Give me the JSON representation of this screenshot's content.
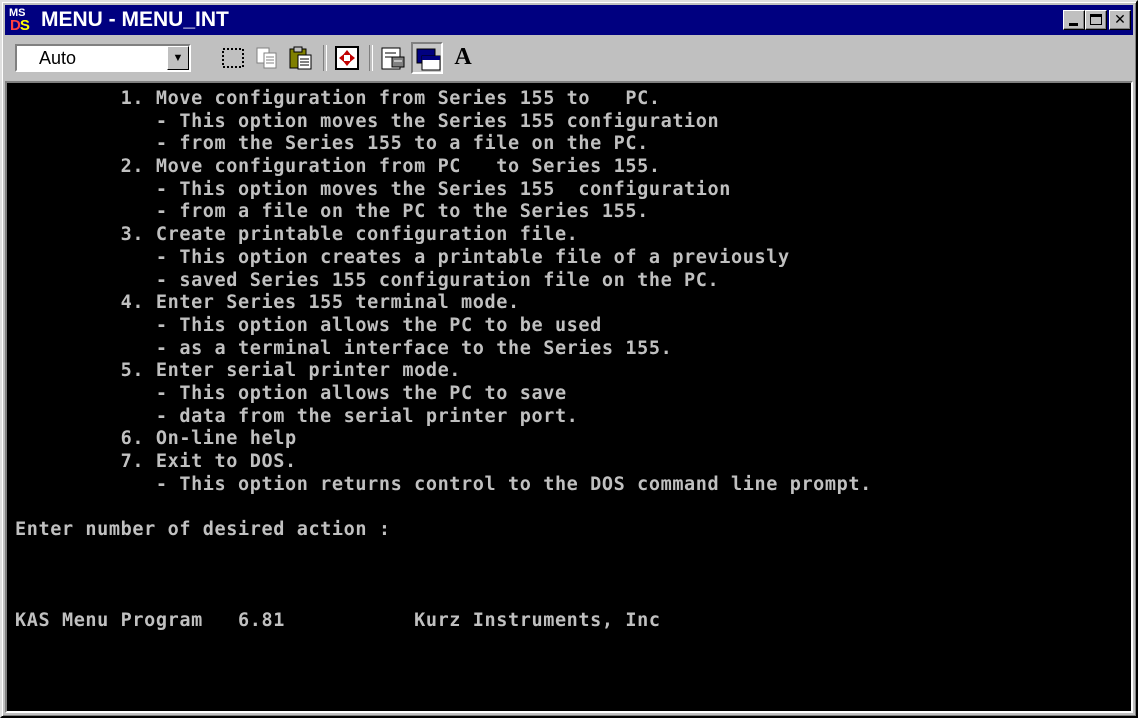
{
  "window": {
    "title": "MENU - MENU_INT",
    "icon_text_top": "MS",
    "icon_text_bottom": "DOS",
    "title_controls": [
      "minimize",
      "maximize",
      "close"
    ]
  },
  "toolbar": {
    "font_size_value": "Auto",
    "buttons": [
      "mark",
      "copy",
      "paste",
      "full-screen",
      "properties",
      "background",
      "font"
    ],
    "font_button_label": "A"
  },
  "console": {
    "lines": [
      "         1. Move configuration from Series 155 to   PC.",
      "            - This option moves the Series 155 configuration",
      "            - from the Series 155 to a file on the PC.",
      "         2. Move configuration from PC   to Series 155.",
      "            - This option moves the Series 155  configuration",
      "            - from a file on the PC to the Series 155.",
      "         3. Create printable configuration file.",
      "            - This option creates a printable file of a previously",
      "            - saved Series 155 configuration file on the PC.",
      "         4. Enter Series 155 terminal mode.",
      "            - This option allows the PC to be used",
      "            - as a terminal interface to the Series 155.",
      "         5. Enter serial printer mode.",
      "            - This option allows the PC to save",
      "            - data from the serial printer port.",
      "         6. On-line help",
      "         7. Exit to DOS.",
      "            - This option returns control to the DOS command line prompt.",
      "",
      "Enter number of desired action :",
      "",
      "",
      "",
      "KAS Menu Program   6.81           Kurz Instruments, Inc"
    ]
  },
  "colors": {
    "titlebar": "#000080",
    "console_bg": "#000000",
    "console_fg": "#c0c0c0",
    "chrome": "#c0c0c0"
  }
}
